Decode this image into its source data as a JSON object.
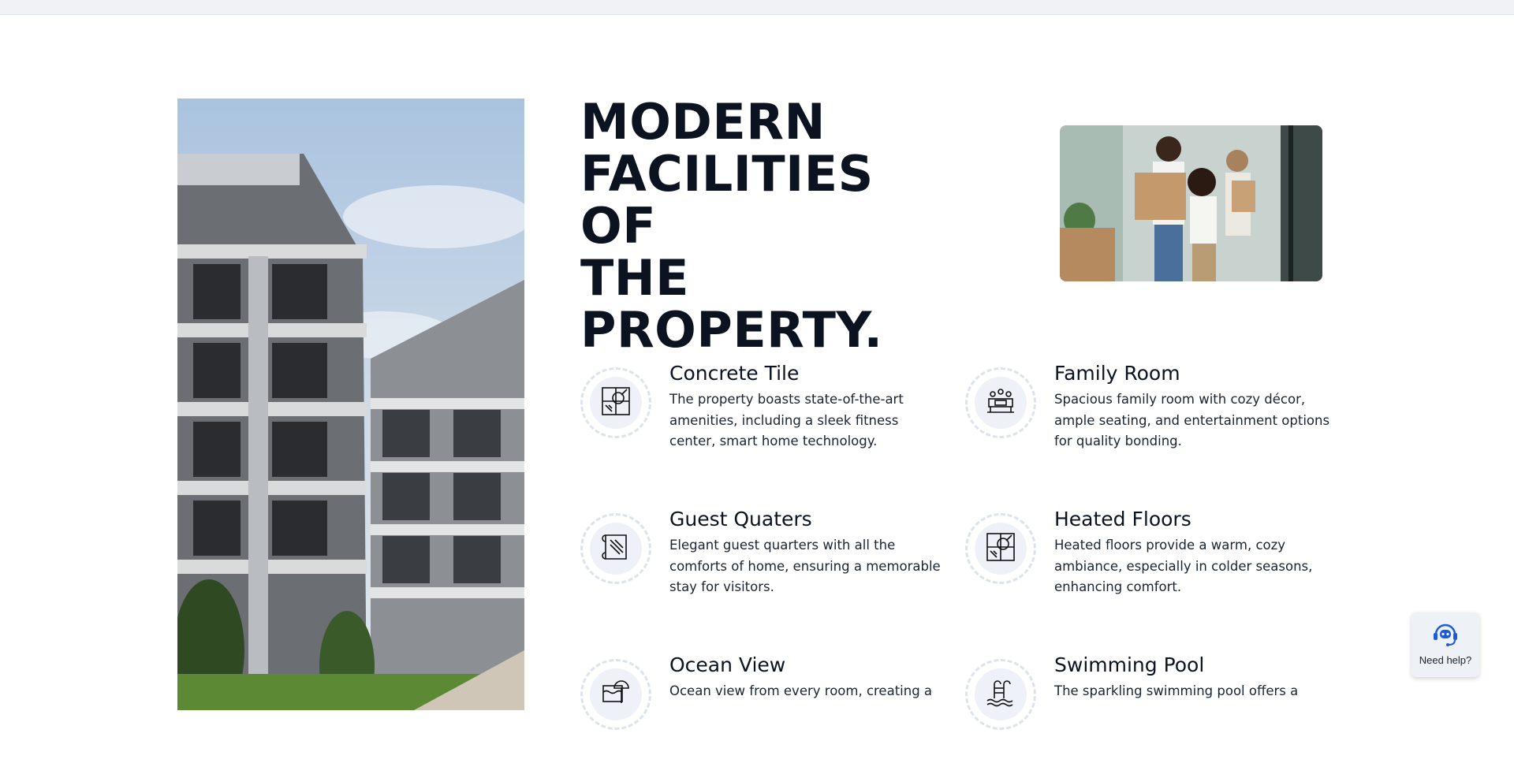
{
  "heading": {
    "lines": [
      "MODERN",
      "FACILITIES OF",
      "THE",
      "PROPERTY."
    ]
  },
  "features": [
    {
      "title": "Concrete Tile",
      "description": "The property boasts state-of-the-art amenities, including a sleek fitness center, smart home technology.",
      "icon": "tile-icon"
    },
    {
      "title": "Family Room",
      "description": "Spacious family room with cozy décor, ample seating, and entertainment options for quality bonding.",
      "icon": "family-room-icon"
    },
    {
      "title": "Guest Quaters",
      "description": "Elegant guest quarters with all the comforts of home, ensuring a memorable stay for visitors.",
      "icon": "guest-quarters-icon"
    },
    {
      "title": "Heated Floors",
      "description": "Heated floors provide a warm, cozy ambiance, especially in colder seasons, enhancing comfort.",
      "icon": "heated-floors-icon"
    },
    {
      "title": "Ocean View",
      "description": "Ocean view from every room, creating a",
      "icon": "ocean-view-icon"
    },
    {
      "title": "Swimming Pool",
      "description": "The sparkling swimming pool offers a",
      "icon": "swimming-pool-icon"
    }
  ],
  "help_widget": {
    "label": "Need help?",
    "icon": "support-bot-icon"
  },
  "colors": {
    "heading": "#0b1220",
    "icon_bg": "#eef2f8",
    "icon_ring": "#dde3ec",
    "help_icon": "#1e5bd6"
  }
}
